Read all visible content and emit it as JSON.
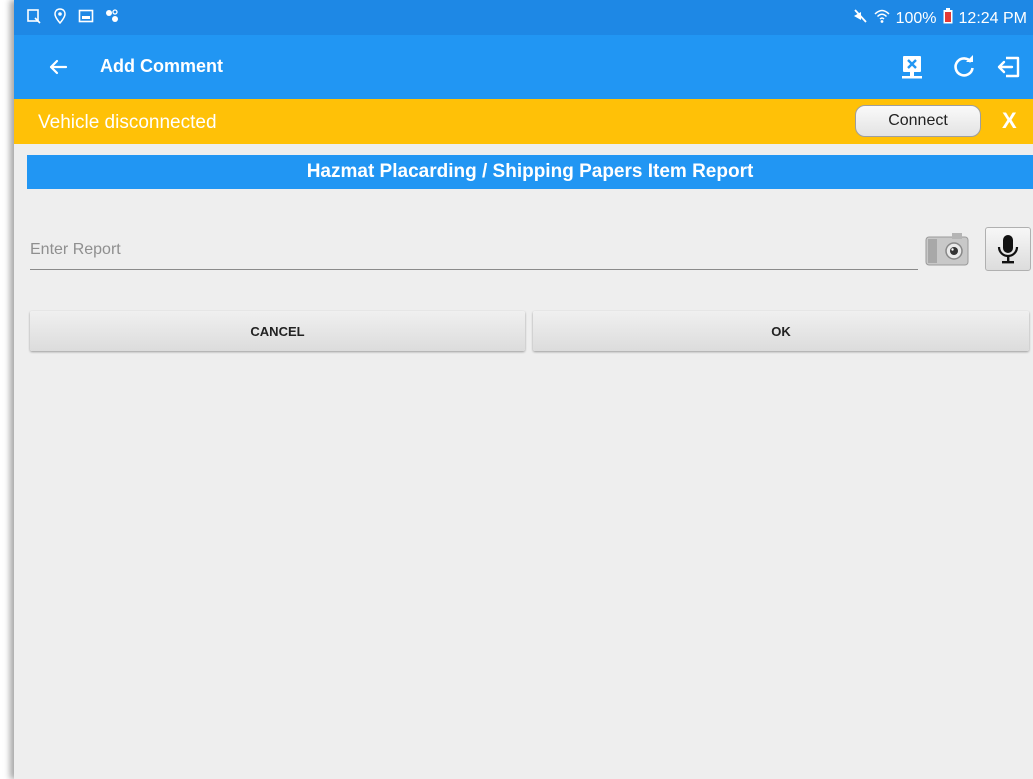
{
  "status_bar": {
    "battery": "100%",
    "time": "12:24 PM"
  },
  "app_bar": {
    "title": "Add Comment"
  },
  "banner": {
    "message": "Vehicle disconnected",
    "connect_label": "Connect",
    "close_label": "X"
  },
  "section": {
    "title": "Hazmat Placarding / Shipping Papers Item Report"
  },
  "report": {
    "placeholder": "Enter Report",
    "value": ""
  },
  "actions": {
    "cancel_label": "CANCEL",
    "ok_label": "OK"
  },
  "colors": {
    "status_bar": "#1e88e5",
    "app_bar": "#2196f3",
    "banner": "#ffc107",
    "background": "#eeeeee"
  }
}
